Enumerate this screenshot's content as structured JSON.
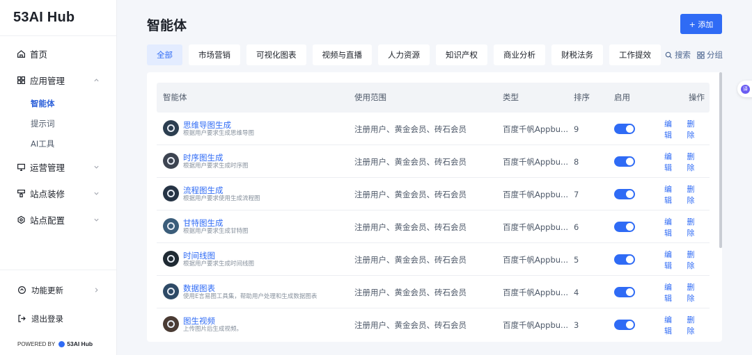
{
  "app": {
    "logo": "53AI Hub"
  },
  "sidebar": {
    "items": [
      {
        "label": "首页",
        "icon": "home-icon"
      },
      {
        "label": "应用管理",
        "icon": "apps-icon",
        "expanded": true,
        "children": [
          {
            "label": "智能体",
            "active": true
          },
          {
            "label": "提示词"
          },
          {
            "label": "AI工具"
          }
        ]
      },
      {
        "label": "运营管理",
        "icon": "monitor-icon"
      },
      {
        "label": "站点装修",
        "icon": "brush-icon"
      },
      {
        "label": "站点配置",
        "icon": "gear-icon"
      }
    ],
    "footer": {
      "update": "功能更新",
      "logout": "退出登录",
      "powered_by": "POWERED BY",
      "powered_brand": "53AI Hub"
    }
  },
  "header": {
    "title": "智能体",
    "add_button": "+ 添加"
  },
  "tabs": [
    "全部",
    "市场营销",
    "可视化图表",
    "视频与直播",
    "人力资源",
    "知识产权",
    "商业分析",
    "财税法务",
    "工作提效"
  ],
  "tools": {
    "search": "搜索",
    "group": "分组"
  },
  "table": {
    "columns": [
      "智能体",
      "使用范围",
      "类型",
      "排序",
      "启用",
      "操作"
    ],
    "rows": [
      {
        "name": "思维导图生成",
        "desc": "根据用户要求生成思维导图",
        "scope": "注册用户、黄金会员、砖石会员",
        "type": "百度千帆Appbu...",
        "order": "9",
        "enabled": true
      },
      {
        "name": "时序图生成",
        "desc": "根据用户要求生成时序图",
        "scope": "注册用户、黄金会员、砖石会员",
        "type": "百度千帆Appbu...",
        "order": "8",
        "enabled": true
      },
      {
        "name": "流程图生成",
        "desc": "根据用户要求使用生成流程图",
        "scope": "注册用户、黄金会员、砖石会员",
        "type": "百度千帆Appbu...",
        "order": "7",
        "enabled": true
      },
      {
        "name": "甘特图生成",
        "desc": "根据用户要求生成甘特图",
        "scope": "注册用户、黄金会员、砖石会员",
        "type": "百度千帆Appbu...",
        "order": "6",
        "enabled": true
      },
      {
        "name": "时间线图",
        "desc": "根据用户要求生成时间线图",
        "scope": "注册用户、黄金会员、砖石会员",
        "type": "百度千帆Appbu...",
        "order": "5",
        "enabled": true
      },
      {
        "name": "数据图表",
        "desc": "使用E言易图工具集，帮助用户处理和生成数据图表",
        "scope": "注册用户、黄金会员、砖石会员",
        "type": "百度千帆Appbu...",
        "order": "4",
        "enabled": true
      },
      {
        "name": "图生视频",
        "desc": "上传图片后生成视频。",
        "scope": "注册用户、黄金会员、砖石会员",
        "type": "百度千帆Appbu...",
        "order": "3",
        "enabled": true
      }
    ],
    "actions": {
      "edit": "编辑",
      "delete": "删除"
    }
  },
  "floating": {
    "badge": "译"
  },
  "colors": {
    "accent": "#2f6bf5",
    "active_tab_bg": "#e3ecff"
  }
}
